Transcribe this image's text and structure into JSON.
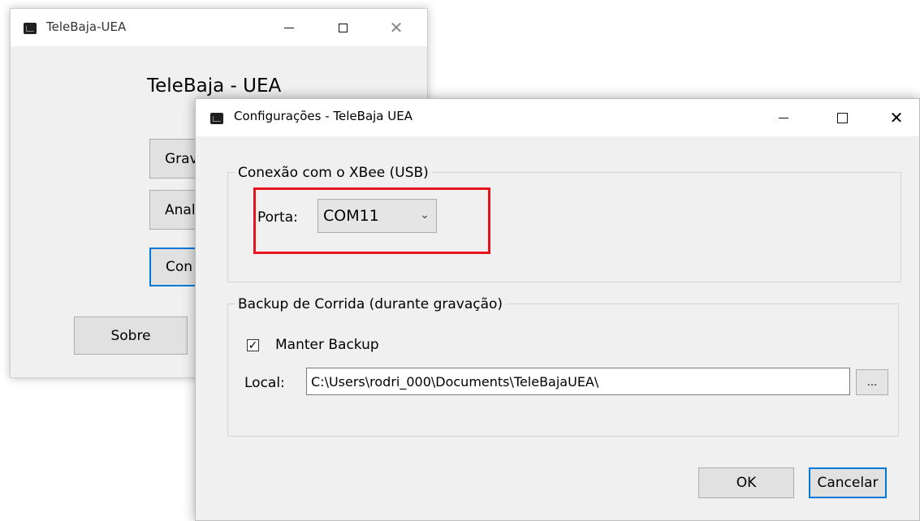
{
  "main_window": {
    "title": "TeleBaja-UEA",
    "heading": "TeleBaja - UEA",
    "buttons": {
      "gravar": "Grav",
      "analisar": "Anali",
      "configuracoes": "Con",
      "sobre": "Sobre"
    }
  },
  "config_window": {
    "title": "Configurações - TeleBaja UEA",
    "xbee_group": {
      "label": "Conexão com o XBee (USB)",
      "port_label": "Porta:",
      "port_value": "COM11"
    },
    "backup_group": {
      "label": "Backup de Corrida (durante gravação)",
      "keep_backup_label": "Manter Backup",
      "keep_backup_checked": true,
      "local_label": "Local:",
      "local_value": "C:\\Users\\rodri_000\\Documents\\TeleBajaUEA\\",
      "browse_label": "..."
    },
    "ok_label": "OK",
    "cancel_label": "Cancelar"
  },
  "colors": {
    "highlight": "#e5141d",
    "focus_blue": "#0078d7",
    "window_bg": "#f0f0f0"
  }
}
